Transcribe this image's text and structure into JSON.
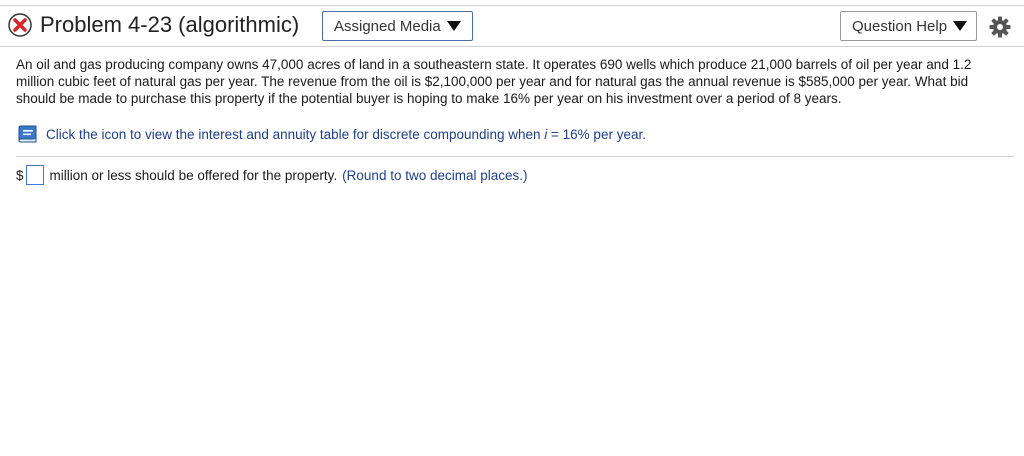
{
  "header": {
    "status": "incorrect",
    "status_icon": "x-circle-icon",
    "title": "Problem 4-23 (algorithmic)",
    "assigned_media_label": "Assigned Media",
    "question_help_label": "Question Help",
    "settings_icon": "gear-icon"
  },
  "problem": {
    "text": "An oil and gas producing company owns 47,000 acres of land in a southeastern state. It operates 690 wells which produce 21,000 barrels of oil per year and 1.2 million cubic feet of natural gas per year. The revenue from the oil is $2,100,000 per year and for natural gas the annual revenue is $585,000 per year. What bid should be made to purchase this property if the potential buyer is hoping to make 16% per year on his investment over a period of 8 years."
  },
  "table_link": {
    "icon": "book-icon",
    "text_before": "Click the icon to view the interest and annuity table for discrete compounding when ",
    "var": "i",
    "text_after": " = 16% per year."
  },
  "answer": {
    "prefix": "$",
    "value": "",
    "suffix": "million or less should be offered for the property.",
    "hint": "(Round to two decimal places.)"
  },
  "colors": {
    "accent": "#1f3f8f",
    "error_red": "#d9262c",
    "input_border": "#3f7bd4"
  }
}
